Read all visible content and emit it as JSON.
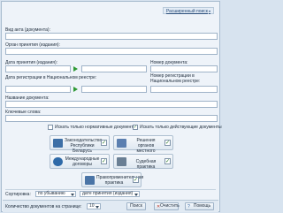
{
  "header": {
    "advanced_search": "Расширенный поиск"
  },
  "fields": {
    "act_type": "Вид акта (документа):",
    "organ": "Орган принятия (издания):",
    "accept_date": "Дата принятия (издания):",
    "doc_number": "Номер документа:",
    "reg_date": "Дата регистрации в Национальном реестре:",
    "reg_number": "Номер регистрации в Национальном реестре:",
    "doc_name": "Название документа:",
    "keywords": "Ключевые слова:"
  },
  "checkboxes": {
    "normative_only": "Искать только нормативные документы",
    "active_only": "Искать только действующие документы"
  },
  "tiles": [
    {
      "label": "Законодательство Республики Беларусь",
      "checked": true,
      "icon": "building-icon"
    },
    {
      "label": "Решения органов местного управления",
      "checked": true,
      "icon": "people-icon"
    },
    {
      "label": "Международные договоры",
      "checked": true,
      "icon": "globe-icon"
    },
    {
      "label": "Судебная практика",
      "checked": true,
      "icon": "gavel-icon"
    },
    {
      "label": "Правоприменительная практика",
      "checked": true,
      "icon": "book-icon"
    }
  ],
  "sort": {
    "label": "Сортировка:",
    "order": "по убыванию",
    "field": "дате принятия (издания)"
  },
  "footer": {
    "count_label": "Количество документов на странице:",
    "count_value": "10",
    "search": "Поиск",
    "clear": "Очистить",
    "help": "Помощь"
  },
  "colors": {
    "accent": "#3d6fa6",
    "go_arrow": "#2f9a35",
    "panel": "#eef3f9"
  }
}
